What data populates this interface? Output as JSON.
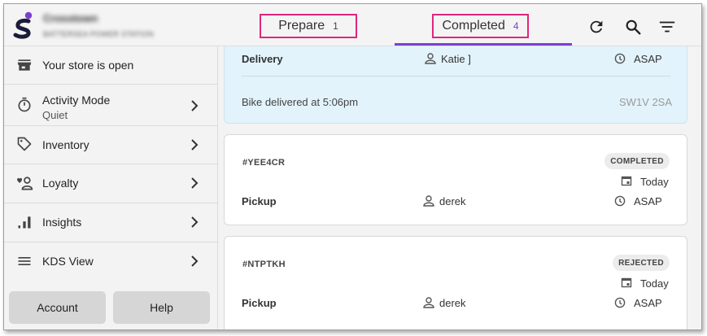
{
  "header": {
    "store_name": "Crosstown",
    "store_subtitle": "BATTERSEA POWER STATION",
    "tabs": [
      {
        "label": "Prepare",
        "count": "1"
      },
      {
        "label": "Completed",
        "count": "4"
      }
    ],
    "icons": [
      "refresh-icon",
      "search-icon",
      "filter-icon"
    ],
    "accent_color": "#7b3fd1",
    "highlight_color": "#e0267c"
  },
  "sidebar": {
    "store_status": "Your store is open",
    "activity_mode": {
      "label": "Activity Mode",
      "value": "Quiet"
    },
    "inventory": "Inventory",
    "loyalty": "Loyalty",
    "insights": "Insights",
    "kds_view": "KDS View",
    "account_button": "Account",
    "help_button": "Help"
  },
  "orders": [
    {
      "type": "Delivery",
      "customer": "Katie ]",
      "time": "ASAP",
      "status_note": "Bike delivered at 5:06pm",
      "postcode": "SW1V 2SA"
    },
    {
      "id": "#YEE4CR",
      "status": "COMPLETED",
      "date": "Today",
      "type": "Pickup",
      "customer": "derek",
      "time": "ASAP"
    },
    {
      "id": "#NTPTKH",
      "status": "REJECTED",
      "date": "Today",
      "type": "Pickup",
      "customer": "derek",
      "time": "ASAP"
    }
  ]
}
